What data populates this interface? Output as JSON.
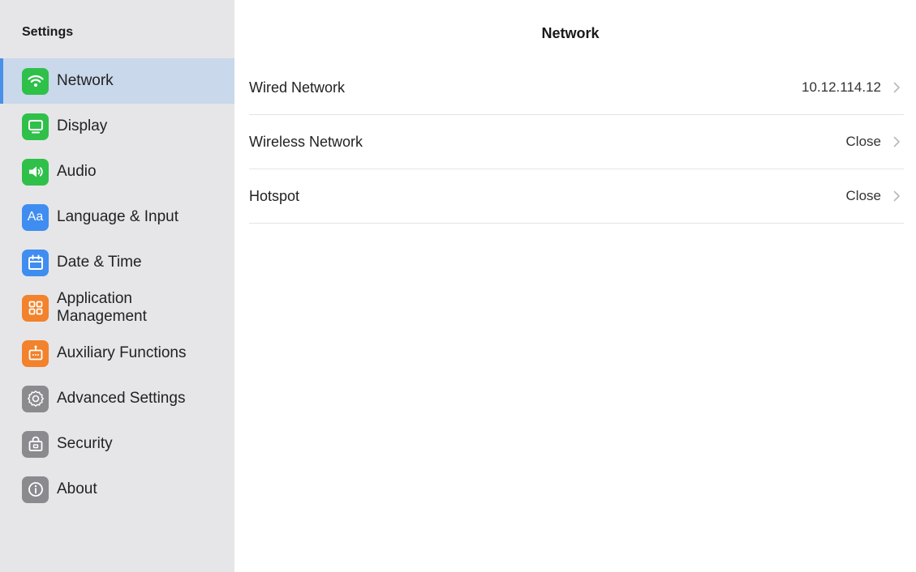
{
  "sidebar": {
    "title": "Settings",
    "items": [
      {
        "label": "Network",
        "icon": "wifi-icon",
        "color": "#2fc04a",
        "active": true
      },
      {
        "label": "Display",
        "icon": "monitor-icon",
        "color": "#2fc04a"
      },
      {
        "label": "Audio",
        "icon": "speaker-icon",
        "color": "#2fc04a"
      },
      {
        "label": "Language & Input",
        "icon": "language-icon",
        "color": "#3f8df0",
        "glyph": "Aa"
      },
      {
        "label": "Date & Time",
        "icon": "calendar-icon",
        "color": "#3f8df0"
      },
      {
        "label": "Application\nManagement",
        "icon": "apps-grid-icon",
        "color": "#f2822b"
      },
      {
        "label": "Auxiliary Functions",
        "icon": "robot-icon",
        "color": "#f2822b"
      },
      {
        "label": "Advanced Settings",
        "icon": "gear-icon",
        "color": "#8a8a8f"
      },
      {
        "label": "Security",
        "icon": "lock-icon",
        "color": "#8a8a8f"
      },
      {
        "label": "About",
        "icon": "info-icon",
        "color": "#8a8a8f"
      }
    ]
  },
  "main": {
    "title": "Network",
    "rows": [
      {
        "label": "Wired Network",
        "value": "10.12.114.12"
      },
      {
        "label": "Wireless Network",
        "value": "Close"
      },
      {
        "label": "Hotspot",
        "value": "Close"
      }
    ]
  },
  "colors": {
    "accent": "#4a8fe8",
    "active_bg": "#c9d8ea",
    "sidebar_bg": "#e6e6e8"
  }
}
